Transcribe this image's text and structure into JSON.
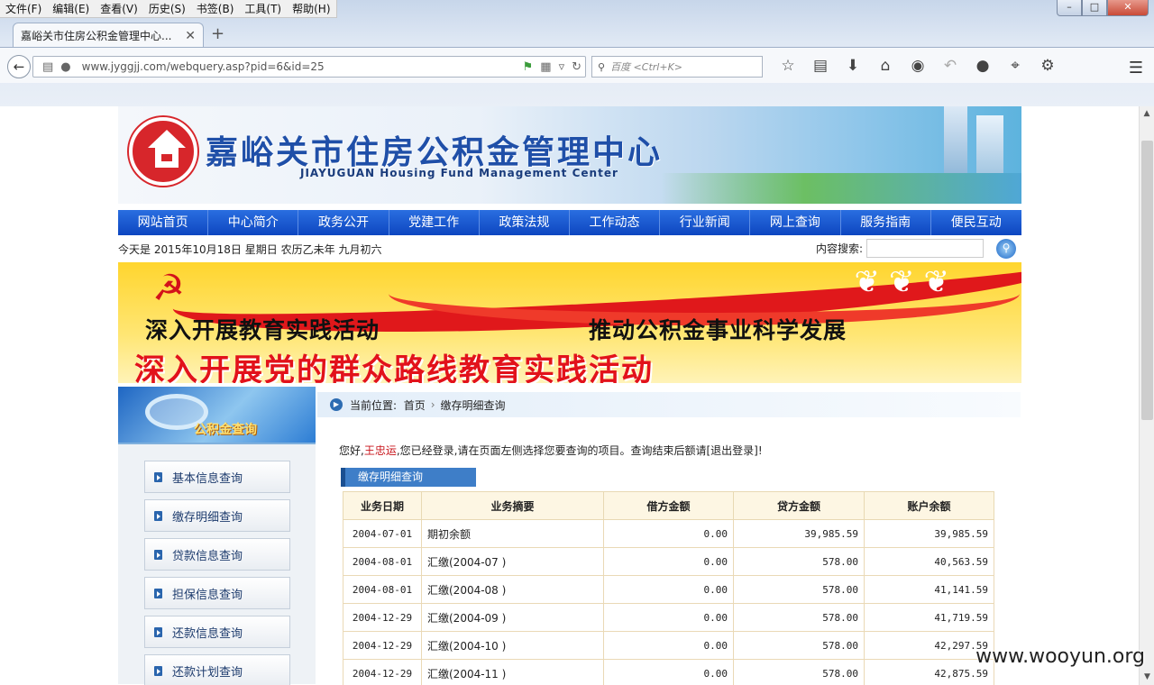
{
  "browser": {
    "menu": [
      "文件(F)",
      "编辑(E)",
      "查看(V)",
      "历史(S)",
      "书签(B)",
      "工具(T)",
      "帮助(H)"
    ],
    "tab_title": "嘉峪关市住房公积金管理中心...",
    "url": "www.jyggjj.com/webquery.asp?pid=6&id=25",
    "search_placeholder": "百度 <Ctrl+K>"
  },
  "site": {
    "name_cn": "嘉峪关市住房公积金管理中心",
    "name_en": "JIAYUGUAN Housing Fund Management Center",
    "nav": [
      "网站首页",
      "中心简介",
      "政务公开",
      "党建工作",
      "政策法规",
      "工作动态",
      "行业新闻",
      "网上查询",
      "服务指南",
      "便民互动"
    ],
    "date_label": "今天是",
    "date": "2015年10月18日",
    "weekday": "星期日",
    "lunar": "农历乙未年",
    "lunar_day": "九月初六",
    "search_label": "内容搜索:",
    "banner_line1": "深入开展教育实践活动",
    "banner_line2": "推动公积金事业科学发展",
    "banner_line3": "深入开展党的群众路线教育实践活动"
  },
  "sidebar": {
    "title": "公积金查询",
    "items": [
      "基本信息查询",
      "缴存明细查询",
      "贷款信息查询",
      "担保信息查询",
      "还款信息查询",
      "还款计划查询"
    ]
  },
  "main": {
    "crumb_label": "当前位置:",
    "crumb_home": "首页",
    "crumb_current": "缴存明细查询",
    "greet_pre": "您好,",
    "user": "王忠运",
    "greet_post": ",您已经登录,请在页面左侧选择您要查询的项目。查询结束后额请[退出登录]!",
    "table_title": "缴存明细查询",
    "columns": [
      "业务日期",
      "业务摘要",
      "借方金额",
      "贷方金额",
      "账户余额"
    ],
    "rows": [
      [
        "2004-07-01",
        "期初余额",
        "0.00",
        "39,985.59",
        "39,985.59"
      ],
      [
        "2004-08-01",
        "汇缴(2004-07 )",
        "0.00",
        "578.00",
        "40,563.59"
      ],
      [
        "2004-08-01",
        "汇缴(2004-08 )",
        "0.00",
        "578.00",
        "41,141.59"
      ],
      [
        "2004-12-29",
        "汇缴(2004-09 )",
        "0.00",
        "578.00",
        "41,719.59"
      ],
      [
        "2004-12-29",
        "汇缴(2004-10 )",
        "0.00",
        "578.00",
        "42,297.59"
      ],
      [
        "2004-12-29",
        "汇缴(2004-11 )",
        "0.00",
        "578.00",
        "42,875.59"
      ]
    ]
  },
  "watermark": "www.wooyun.org"
}
